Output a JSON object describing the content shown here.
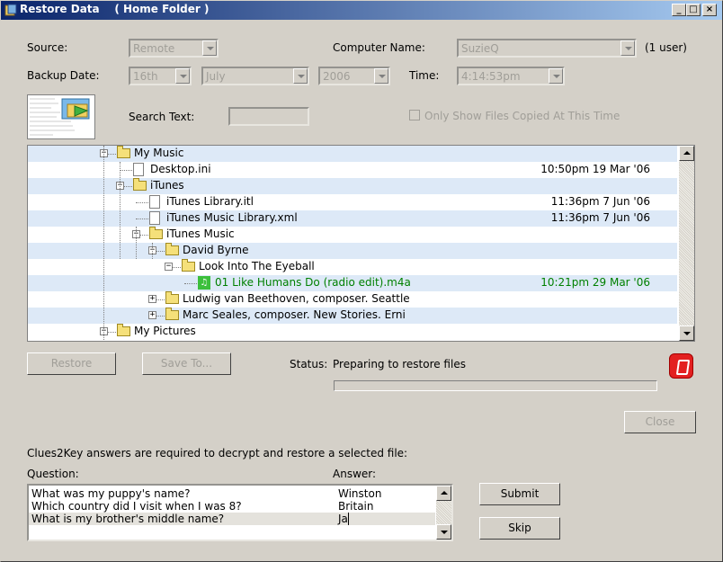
{
  "window": {
    "title": "Restore Data    ( Home Folder )"
  },
  "form": {
    "source_label": "Source:",
    "source_value": "Remote",
    "computer_name_label": "Computer Name:",
    "computer_name_value": "SuzieQ",
    "user_count": "(1 user)",
    "backup_date_label": "Backup Date:",
    "day_value": "16th",
    "month_value": "July",
    "year_value": "2006",
    "time_label": "Time:",
    "time_value": "4:14:53pm",
    "search_label": "Search Text:",
    "search_value": "",
    "only_show_label": "Only Show Files Copied At This Time"
  },
  "tree": {
    "rows": [
      {
        "name": "My Music",
        "date": "",
        "type": "folder"
      },
      {
        "name": "Desktop.ini",
        "date": "10:50pm 19 Mar '06",
        "type": "file"
      },
      {
        "name": "iTunes",
        "date": "",
        "type": "folder"
      },
      {
        "name": "iTunes Library.itl",
        "date": "11:36pm 7 Jun '06",
        "type": "file"
      },
      {
        "name": "iTunes Music Library.xml",
        "date": "11:36pm 7 Jun '06",
        "type": "file"
      },
      {
        "name": "iTunes Music",
        "date": "",
        "type": "folder"
      },
      {
        "name": "David Byrne",
        "date": "",
        "type": "folder"
      },
      {
        "name": "Look Into The Eyeball",
        "date": "",
        "type": "folder"
      },
      {
        "name": "01 Like Humans Do (radio edit).m4a",
        "date": "10:21pm 29 Mar '06",
        "type": "music"
      },
      {
        "name": "Ludwig van Beethoven, composer. Seattle",
        "date": "",
        "type": "folder"
      },
      {
        "name": "Marc Seales, composer. New Stories. Erni",
        "date": "",
        "type": "folder"
      },
      {
        "name": "My Pictures",
        "date": "",
        "type": "folder"
      }
    ]
  },
  "actions": {
    "restore_label": "Restore",
    "save_to_label": "Save To...",
    "status_label": "Status:",
    "status_value": "Preparing to restore files",
    "close_label": "Close"
  },
  "clues": {
    "intro": "Clues2Key answers are required to decrypt and restore a selected file:",
    "question_header": "Question:",
    "answer_header": "Answer:",
    "rows": [
      {
        "question": "What was my puppy's name?",
        "answer": "Winston"
      },
      {
        "question": "Which country did I visit when I was 8?",
        "answer": "Britain"
      },
      {
        "question": "What is my brother's middle name?",
        "answer": "Ja"
      }
    ],
    "submit_label": "Submit",
    "skip_label": "Skip"
  }
}
